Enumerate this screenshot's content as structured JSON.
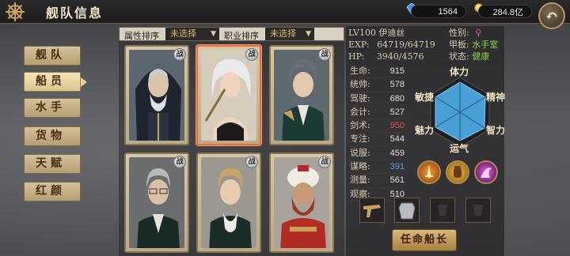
{
  "header": {
    "title": "舰队信息",
    "gems": "1564",
    "gold": "284.8亿"
  },
  "menu": [
    {
      "label": "舰队",
      "active": false
    },
    {
      "label": "船员",
      "active": true
    },
    {
      "label": "水手",
      "active": false
    },
    {
      "label": "货物",
      "active": false
    },
    {
      "label": "天赋",
      "active": false
    },
    {
      "label": "红颜",
      "active": false
    }
  ],
  "filters": {
    "attr_label": "属性排序",
    "attr_value": "未选择",
    "job_label": "职业排序",
    "job_value": "未选择"
  },
  "cards": [
    {
      "badge": "战"
    },
    {
      "badge": "战"
    },
    {
      "badge": "战"
    },
    {
      "badge": "战"
    },
    {
      "badge": "战"
    },
    {
      "badge": "战"
    }
  ],
  "profile": {
    "level_name": "LV100 伊迪丝",
    "exp_label": "EXP:",
    "exp_value": "64719/64719",
    "hp_label": "HP:",
    "hp_value": "3940/4576",
    "gender_label": "性别:",
    "gender_icon": "female-icon",
    "deck_label": "甲板:",
    "deck_value": "水手室",
    "status_label": "状态:",
    "status_value": "健康"
  },
  "stats": [
    {
      "label": "生命:",
      "value": "915",
      "style": ""
    },
    {
      "label": "统帅:",
      "value": "578",
      "style": ""
    },
    {
      "label": "驾驶:",
      "value": "680",
      "style": ""
    },
    {
      "label": "会计:",
      "value": "527",
      "style": ""
    },
    {
      "label": "剑术:",
      "value": "950",
      "style": "red"
    },
    {
      "label": "专注:",
      "value": "544",
      "style": ""
    },
    {
      "label": "说服:",
      "value": "459",
      "style": ""
    },
    {
      "label": "谋略:",
      "value": "391",
      "style": "blue"
    },
    {
      "label": "测量:",
      "value": "561",
      "style": ""
    },
    {
      "label": "观察:",
      "value": "510",
      "style": ""
    }
  ],
  "radar": {
    "labels": [
      "体力",
      "精神",
      "智力",
      "运气",
      "魅力",
      "敏捷"
    ],
    "fill_color": "#4aa6e0"
  },
  "skills": [
    "sword-skill-icon",
    "fist-skill-icon",
    "magic-skill-icon"
  ],
  "equipment": [
    "pistol-icon",
    "armor-icon",
    "empty-slot-icon",
    "empty-slot-icon"
  ],
  "appoint_button": "任命船长",
  "colors": {
    "accent_gold": "#d8b86a",
    "selected_border": "#e86c3c"
  }
}
